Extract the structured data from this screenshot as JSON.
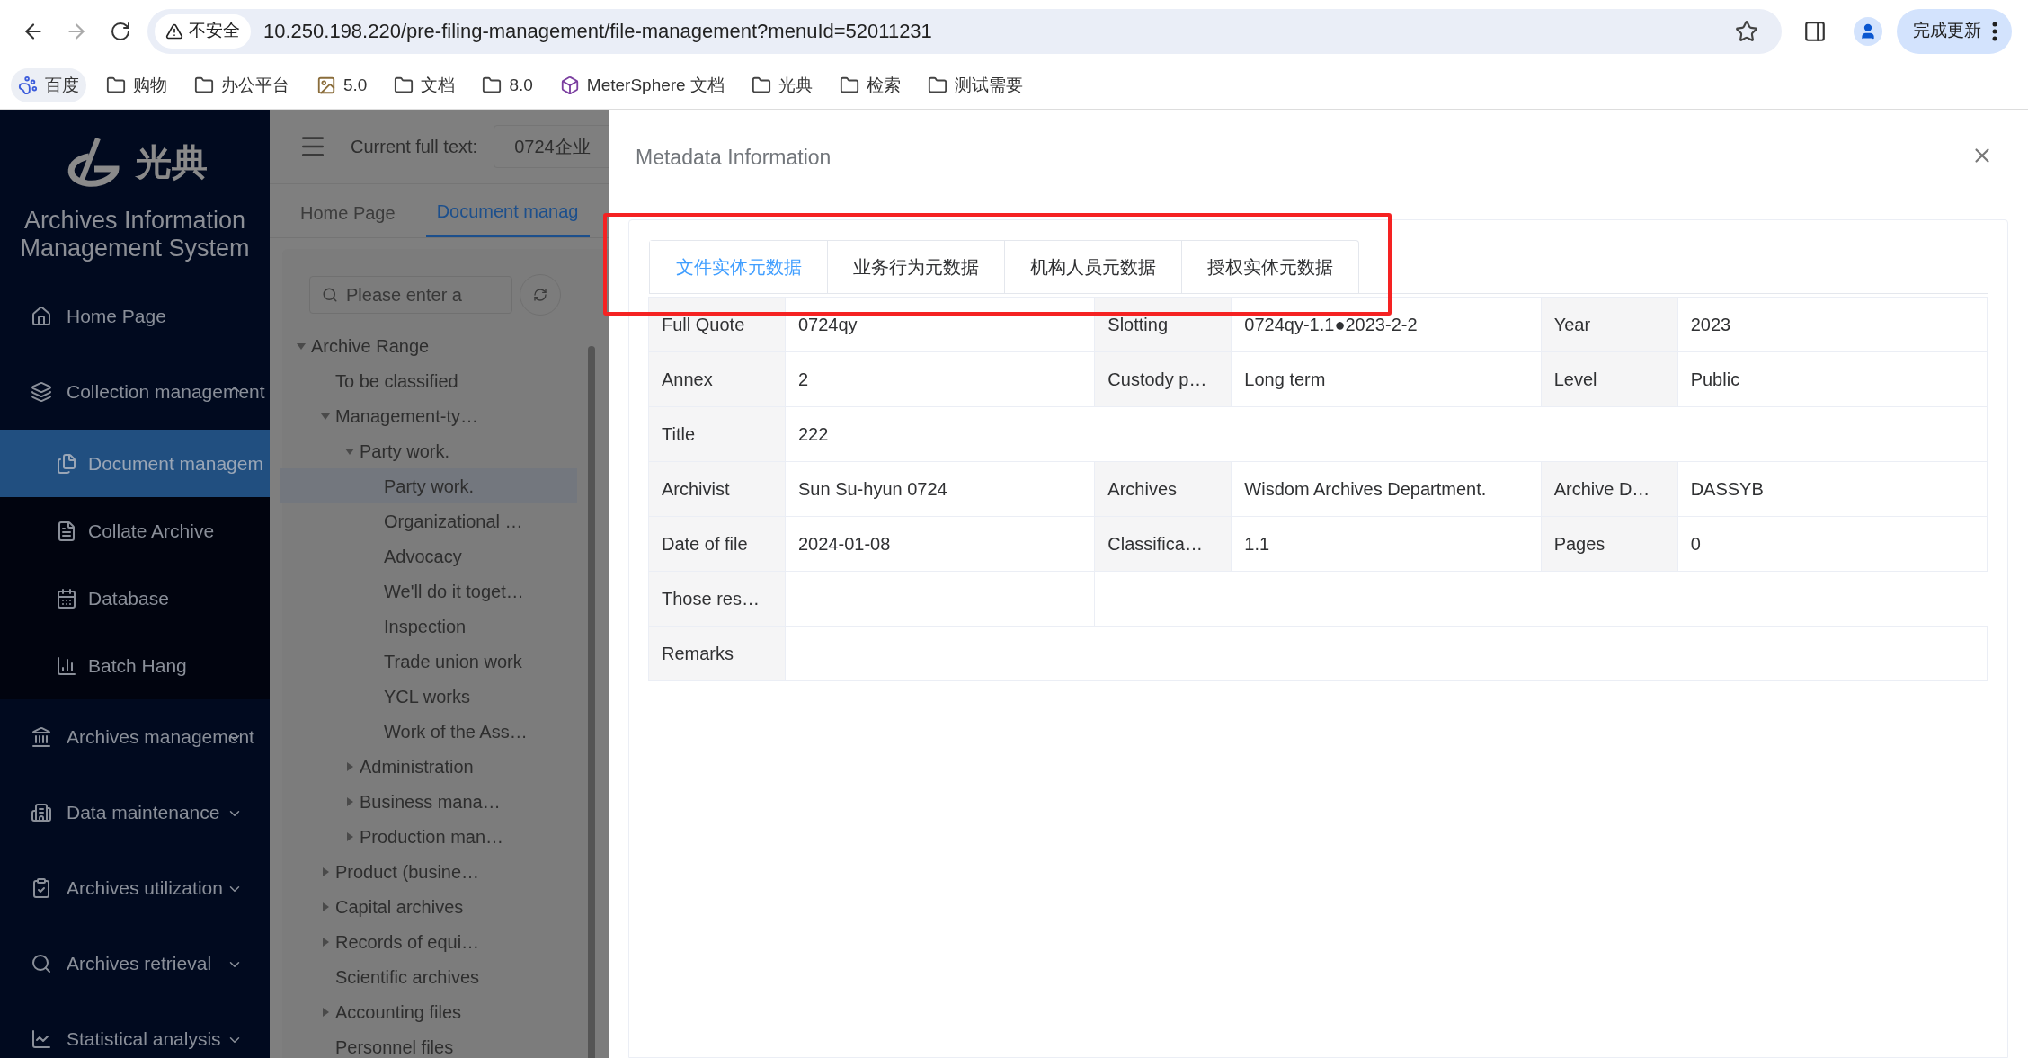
{
  "browser": {
    "security_label": "不安全",
    "url": "10.250.198.220/pre-filing-management/file-management?menuId=52011231",
    "update_button": "完成更新",
    "bookmarks": [
      {
        "label": "百度",
        "kind": "baidu"
      },
      {
        "label": "购物",
        "kind": "folder"
      },
      {
        "label": "办公平台",
        "kind": "folder"
      },
      {
        "label": "5.0",
        "kind": "image"
      },
      {
        "label": "文档",
        "kind": "folder"
      },
      {
        "label": "8.0",
        "kind": "folder"
      },
      {
        "label": "MeterSphere 文档",
        "kind": "cube"
      },
      {
        "label": "光典",
        "kind": "folder"
      },
      {
        "label": "检索",
        "kind": "folder"
      },
      {
        "label": "测试需要",
        "kind": "folder"
      }
    ]
  },
  "sidebar": {
    "logo_text": "光典",
    "system_name": "Archives Information Management System",
    "items": [
      {
        "label": "Home Page",
        "selected": false
      },
      {
        "label": "Collection management",
        "selected": false,
        "expanded": true,
        "children": [
          {
            "label": "Document managem",
            "selected": true
          },
          {
            "label": "Collate Archive",
            "selected": false
          },
          {
            "label": "Database",
            "selected": false
          },
          {
            "label": "Batch Hang",
            "selected": false
          }
        ]
      },
      {
        "label": "Archives management",
        "selected": false,
        "expanded": false
      },
      {
        "label": "Data maintenance",
        "selected": false,
        "expanded": false
      },
      {
        "label": "Archives utilization",
        "selected": false,
        "expanded": false
      },
      {
        "label": "Archives retrieval",
        "selected": false,
        "expanded": false
      },
      {
        "label": "Statistical analysis",
        "selected": false,
        "expanded": false
      }
    ]
  },
  "header": {
    "current_label": "Current full text:",
    "current_value": "0724企业"
  },
  "page_tabs": [
    {
      "label": "Home Page",
      "selected": false
    },
    {
      "label": "Document manag",
      "selected": true
    }
  ],
  "tree": {
    "search_placeholder": "Please enter a",
    "nodes": [
      {
        "label": "Archive Range",
        "expanded": true,
        "selected": false,
        "children": [
          {
            "label": "To be classified",
            "selected": false
          },
          {
            "label": "Management-ty…",
            "expanded": true,
            "selected": false,
            "children": [
              {
                "label": "Party work.",
                "expanded": true,
                "selected": false,
                "children": [
                  {
                    "label": "Party work.",
                    "selected": true
                  },
                  {
                    "label": "Organizational …",
                    "selected": false
                  },
                  {
                    "label": "Advocacy",
                    "selected": false
                  },
                  {
                    "label": "We'll do it toget…",
                    "selected": false
                  },
                  {
                    "label": "Inspection",
                    "selected": false
                  },
                  {
                    "label": "Trade union work",
                    "selected": false
                  },
                  {
                    "label": "YCL works",
                    "selected": false
                  },
                  {
                    "label": "Work of the Ass…",
                    "selected": false
                  }
                ]
              },
              {
                "label": "Administration",
                "expanded": false,
                "selected": false
              },
              {
                "label": "Business mana…",
                "expanded": false,
                "selected": false
              },
              {
                "label": "Production man…",
                "expanded": false,
                "selected": false
              }
            ]
          },
          {
            "label": "Product (busine…",
            "expanded": false,
            "selected": false
          },
          {
            "label": "Capital archives",
            "expanded": false,
            "selected": false
          },
          {
            "label": "Records of equi…",
            "expanded": false,
            "selected": false
          },
          {
            "label": "Scientific archives",
            "selected": false
          },
          {
            "label": "Accounting files",
            "expanded": false,
            "selected": false
          },
          {
            "label": "Personnel files",
            "selected": false
          }
        ]
      }
    ]
  },
  "drawer": {
    "title": "Metadata Information",
    "tabs": [
      {
        "label": "文件实体元数据",
        "selected": true
      },
      {
        "label": "业务行为元数据",
        "selected": false
      },
      {
        "label": "机构人员元数据",
        "selected": false
      },
      {
        "label": "授权实体元数据",
        "selected": false
      }
    ],
    "rows": [
      {
        "kind": "grid",
        "fields": [
          {
            "label": "Full Quote",
            "value": "0724qy"
          },
          {
            "label": "Slotting",
            "value": "0724qy-1.1●2023-2-2"
          },
          {
            "label": "Year",
            "value": "2023"
          }
        ]
      },
      {
        "kind": "grid",
        "fields": [
          {
            "label": "Annex",
            "value": "2"
          },
          {
            "label": "Custody p…",
            "value": "Long term"
          },
          {
            "label": "Level",
            "value": "Public"
          }
        ]
      },
      {
        "kind": "full",
        "fields": [
          {
            "label": "Title",
            "value": "222"
          }
        ]
      },
      {
        "kind": "grid",
        "fields": [
          {
            "label": "Archivist",
            "value": "Sun Su-hyun 0724"
          },
          {
            "label": "Archives",
            "value": "Wisdom Archives Department."
          },
          {
            "label": "Archive D…",
            "value": "DASSYB"
          }
        ]
      },
      {
        "kind": "grid",
        "fields": [
          {
            "label": "Date of file",
            "value": "2024-01-08"
          },
          {
            "label": "Classifica…",
            "value": "1.1"
          },
          {
            "label": "Pages",
            "value": "0"
          }
        ]
      },
      {
        "kind": "grid",
        "fields": [
          {
            "label": "Those res…"
          }
        ]
      },
      {
        "kind": "full",
        "fields": [
          {
            "label": "Remarks"
          }
        ]
      }
    ]
  }
}
